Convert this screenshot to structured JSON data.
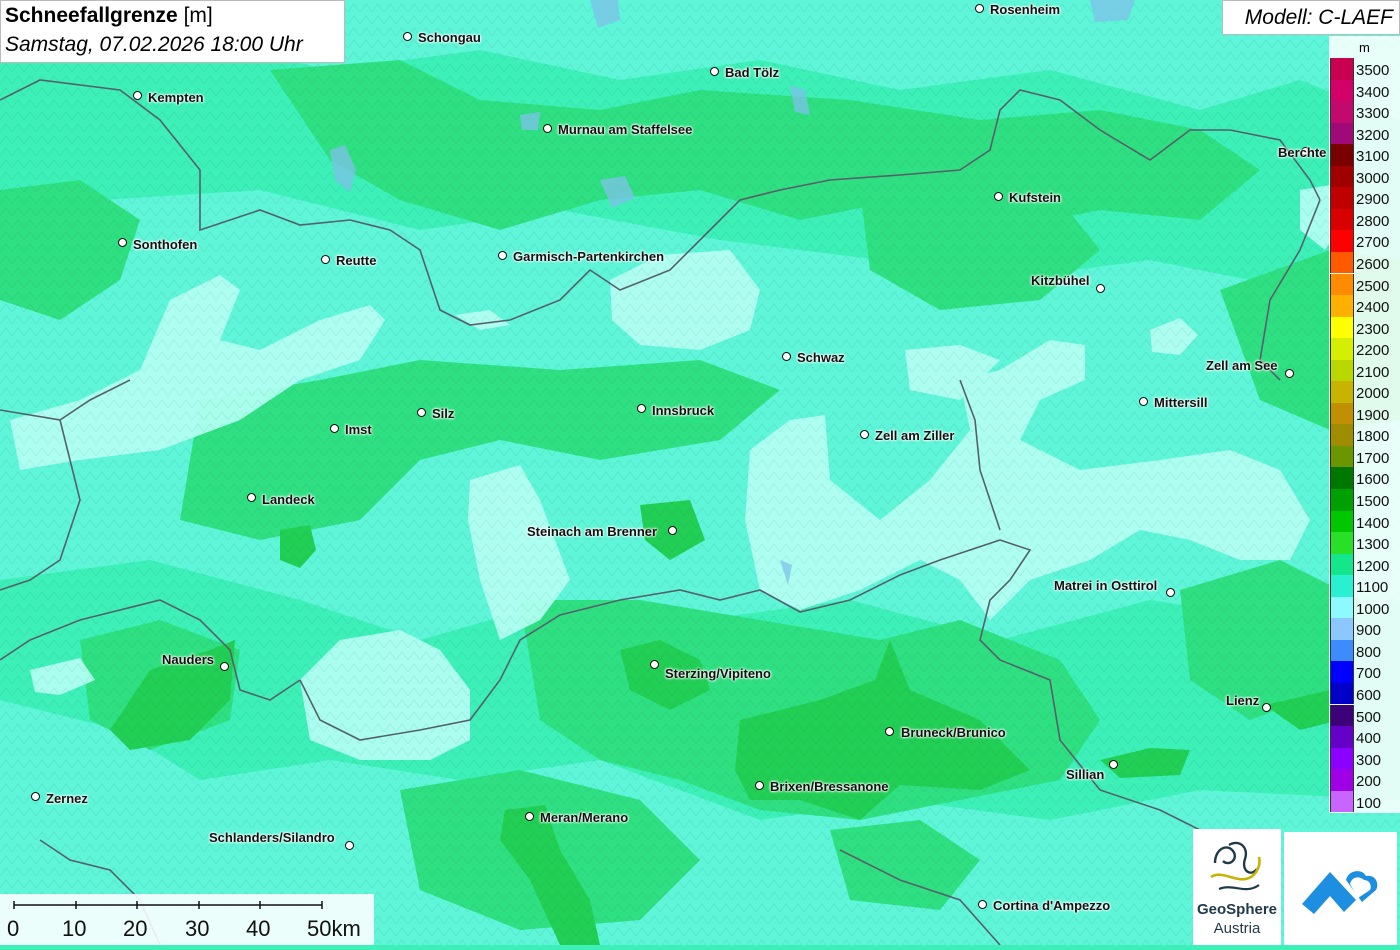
{
  "title": {
    "main": "Schneefallgrenze",
    "unit": "[m]",
    "datetime": "Samstag, 07.02.2026 18:00 Uhr"
  },
  "model": "Modell: C-LAEF",
  "legend": {
    "unit": "m",
    "entries": [
      {
        "label": "3500",
        "color": "#c8004f"
      },
      {
        "label": "3400",
        "color": "#d3006a"
      },
      {
        "label": "3300",
        "color": "#c20a6e"
      },
      {
        "label": "3200",
        "color": "#a00a78"
      },
      {
        "label": "3100",
        "color": "#7a0000"
      },
      {
        "label": "3000",
        "color": "#a00000"
      },
      {
        "label": "2900",
        "color": "#c00000"
      },
      {
        "label": "2800",
        "color": "#d80000"
      },
      {
        "label": "2700",
        "color": "#ff0000"
      },
      {
        "label": "2600",
        "color": "#ff5a00"
      },
      {
        "label": "2500",
        "color": "#ff8c00"
      },
      {
        "label": "2400",
        "color": "#ffb000"
      },
      {
        "label": "2300",
        "color": "#ffff00"
      },
      {
        "label": "2200",
        "color": "#d4f000"
      },
      {
        "label": "2100",
        "color": "#b8d800"
      },
      {
        "label": "2000",
        "color": "#c8b400"
      },
      {
        "label": "1900",
        "color": "#c09000"
      },
      {
        "label": "1800",
        "color": "#a08c00"
      },
      {
        "label": "1700",
        "color": "#6b9600"
      },
      {
        "label": "1600",
        "color": "#007800"
      },
      {
        "label": "1500",
        "color": "#00a000"
      },
      {
        "label": "1400",
        "color": "#00c800"
      },
      {
        "label": "1300",
        "color": "#28e028"
      },
      {
        "label": "1200",
        "color": "#14e68c"
      },
      {
        "label": "1100",
        "color": "#28f0d0"
      },
      {
        "label": "1000",
        "color": "#8cfaff"
      },
      {
        "label": "900",
        "color": "#8cc8ff"
      },
      {
        "label": "800",
        "color": "#3c8cff"
      },
      {
        "label": "700",
        "color": "#0000ff"
      },
      {
        "label": "600",
        "color": "#0000c8"
      },
      {
        "label": "500",
        "color": "#3c0078"
      },
      {
        "label": "400",
        "color": "#6400c8"
      },
      {
        "label": "300",
        "color": "#8c00ff"
      },
      {
        "label": "200",
        "color": "#a000e6"
      },
      {
        "label": "100",
        "color": "#c864ff"
      }
    ]
  },
  "cities": [
    {
      "name": "Schongau"
    },
    {
      "name": "Rosenheim"
    },
    {
      "name": "Bad Tölz"
    },
    {
      "name": "Kempten"
    },
    {
      "name": "Murnau am Staffelsee"
    },
    {
      "name": "Berchte"
    },
    {
      "name": "Kufstein"
    },
    {
      "name": "Sonthofen"
    },
    {
      "name": "Reutte"
    },
    {
      "name": "Garmisch-Partenkirchen"
    },
    {
      "name": "Kitzbühel"
    },
    {
      "name": "Schwaz"
    },
    {
      "name": "Zell am See"
    },
    {
      "name": "Mittersill"
    },
    {
      "name": "Innsbruck"
    },
    {
      "name": "Silz"
    },
    {
      "name": "Imst"
    },
    {
      "name": "Zell am Ziller"
    },
    {
      "name": "Landeck"
    },
    {
      "name": "Steinach am Brenner"
    },
    {
      "name": "Matrei in Osttirol"
    },
    {
      "name": "Nauders"
    },
    {
      "name": "Sterzing/Vipiteno"
    },
    {
      "name": "Lienz"
    },
    {
      "name": "Bruneck/Brunico"
    },
    {
      "name": "Sillian"
    },
    {
      "name": "Brixen/Bressanone"
    },
    {
      "name": "Zernez"
    },
    {
      "name": "Meran/Merano"
    },
    {
      "name": "Schlanders/Silandro"
    },
    {
      "name": "Cortina d'Ampezzo"
    }
  ],
  "scale": {
    "ticks": [
      "0",
      "10",
      "20",
      "30",
      "40",
      "50km"
    ]
  },
  "logos": {
    "geosphere_line1": "GeoSphere",
    "geosphere_line2": "Austria"
  },
  "colors": {
    "base": "#3cf0b8",
    "light": "#b4fff4",
    "cyan": "#5ef5d8",
    "green": "#2fe082",
    "darkgreen": "#22cf55",
    "border": "#55606a"
  }
}
